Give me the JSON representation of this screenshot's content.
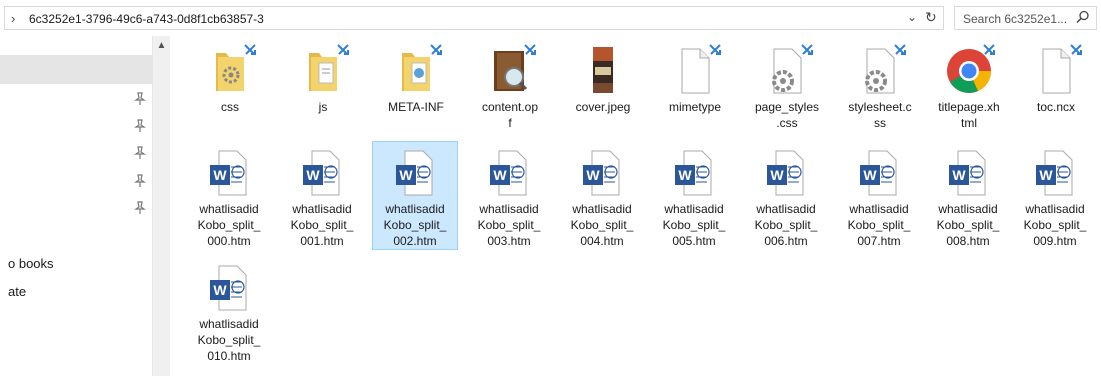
{
  "address": {
    "path": "6c3252e1-3796-49c6-a743-0d8f1cb63857-3",
    "search_placeholder": "Search 6c3252e1..."
  },
  "nav": {
    "items": [
      {
        "label": "o books"
      },
      {
        "label": "ate"
      }
    ]
  },
  "files": [
    {
      "name": "css",
      "type": "folder-gear"
    },
    {
      "name": "js",
      "type": "folder-doc"
    },
    {
      "name": "META-INF",
      "type": "folder-web"
    },
    {
      "name": "content.opf",
      "type": "book"
    },
    {
      "name": "cover.jpeg",
      "type": "image"
    },
    {
      "name": "mimetype",
      "type": "blank"
    },
    {
      "name": "page_styles.css",
      "type": "gear"
    },
    {
      "name": "stylesheet.css",
      "type": "gear"
    },
    {
      "name": "titlepage.xhtml",
      "type": "chrome"
    },
    {
      "name": "toc.ncx",
      "type": "blank"
    },
    {
      "name": "whatlisadidKobo_split_000.htm",
      "type": "word"
    },
    {
      "name": "whatlisadidKobo_split_001.htm",
      "type": "word"
    },
    {
      "name": "whatlisadidKobo_split_002.htm",
      "type": "word",
      "selected": true
    },
    {
      "name": "whatlisadidKobo_split_003.htm",
      "type": "word"
    },
    {
      "name": "whatlisadidKobo_split_004.htm",
      "type": "word"
    },
    {
      "name": "whatlisadidKobo_split_005.htm",
      "type": "word"
    },
    {
      "name": "whatlisadidKobo_split_006.htm",
      "type": "word"
    },
    {
      "name": "whatlisadidKobo_split_007.htm",
      "type": "word"
    },
    {
      "name": "whatlisadidKobo_split_008.htm",
      "type": "word"
    },
    {
      "name": "whatlisadidKobo_split_009.htm",
      "type": "word"
    },
    {
      "name": "whatlisadidKobo_split_010.htm",
      "type": "word"
    }
  ],
  "labels": {
    "f0": [
      "css"
    ],
    "f1": [
      "js"
    ],
    "f2": [
      "META-INF"
    ],
    "f3": [
      "content.op",
      "f"
    ],
    "f4": [
      "cover.jpeg"
    ],
    "f5": [
      "mimetype"
    ],
    "f6": [
      "page_styles",
      ".css"
    ],
    "f7": [
      "stylesheet.c",
      "ss"
    ],
    "f8": [
      "titlepage.xh",
      "tml"
    ],
    "f9": [
      "toc.ncx"
    ],
    "w": [
      "whatlisadid",
      "Kobo_split_"
    ],
    "w0": "000.htm",
    "w1": "001.htm",
    "w2": "002.htm",
    "w3": "003.htm",
    "w4": "004.htm",
    "w5": "005.htm",
    "w6": "006.htm",
    "w7": "007.htm",
    "w8": "008.htm",
    "w9": "009.htm",
    "w10": "010.htm"
  },
  "colors": {
    "selection_bg": "#cce8ff",
    "selection_border": "#99d1ff",
    "word_blue": "#2b579a",
    "folder_yellow": "#f3d36b",
    "sync_blue": "#2f7fd6"
  }
}
